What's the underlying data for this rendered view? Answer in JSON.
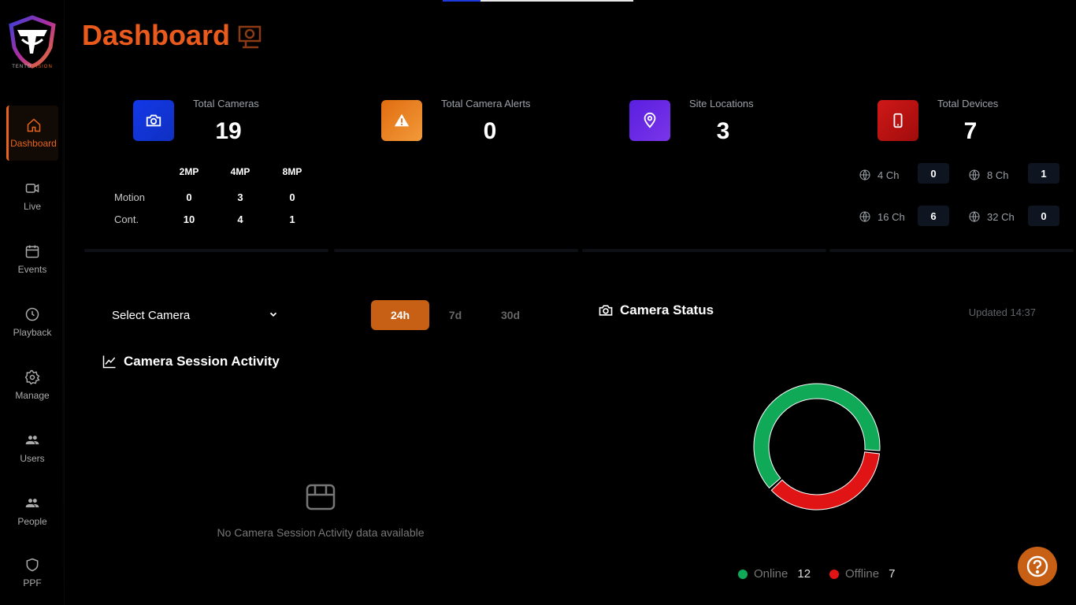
{
  "app": {
    "brand_prefix": "TENTO",
    "brand_suffix": "VISION",
    "progress_fraction": 0.2
  },
  "sidebar": {
    "items": [
      {
        "label": "Dashboard",
        "icon": "home-icon",
        "active": true
      },
      {
        "label": "Live",
        "icon": "video-camera-icon"
      },
      {
        "label": "Events",
        "icon": "calendar-icon"
      },
      {
        "label": "Playback",
        "icon": "clock-icon"
      },
      {
        "label": "Manage",
        "icon": "gear-icon"
      },
      {
        "label": "Users",
        "icon": "users-icon"
      },
      {
        "label": "People",
        "icon": "people-icon"
      },
      {
        "label": "PPF",
        "icon": "shield-icon"
      }
    ]
  },
  "header": {
    "title": "Dashboard"
  },
  "stats": {
    "cameras": {
      "label": "Total Cameras",
      "value": "19",
      "color": "#1a3bdb"
    },
    "alerts": {
      "label": "Total Camera Alerts",
      "value": "0",
      "color": "#f08a24"
    },
    "sites": {
      "label": "Site Locations",
      "value": "3",
      "color": "#6a2bd9"
    },
    "devices": {
      "label": "Total Devices",
      "value": "7",
      "color": "#c41414"
    }
  },
  "mp_table": {
    "columns": [
      "2MP",
      "4MP",
      "8MP"
    ],
    "column_colors": [
      "#1428c8",
      "#1e6b1e",
      "#a8470e"
    ],
    "rows": [
      {
        "label": "Motion",
        "values": [
          "0",
          "3",
          "0"
        ]
      },
      {
        "label": "Cont.",
        "values": [
          "10",
          "4",
          "1"
        ]
      }
    ]
  },
  "channels": [
    {
      "label": "4 Ch",
      "value": "0"
    },
    {
      "label": "8 Ch",
      "value": "1"
    },
    {
      "label": "16 Ch",
      "value": "6"
    },
    {
      "label": "32 Ch",
      "value": "0"
    }
  ],
  "session": {
    "select_value": "Select Camera",
    "ranges": [
      "24h",
      "7d",
      "30d"
    ],
    "active_range": "24h",
    "title": "Camera Session Activity",
    "empty_text": "No Camera Session Activity data available"
  },
  "status": {
    "title": "Camera Status",
    "updated": "Updated 14:37",
    "online_label": "Online",
    "online_value": 12,
    "online_color": "#0fa958",
    "offline_label": "Offline",
    "offline_value": 7,
    "offline_color": "#e01414"
  }
}
